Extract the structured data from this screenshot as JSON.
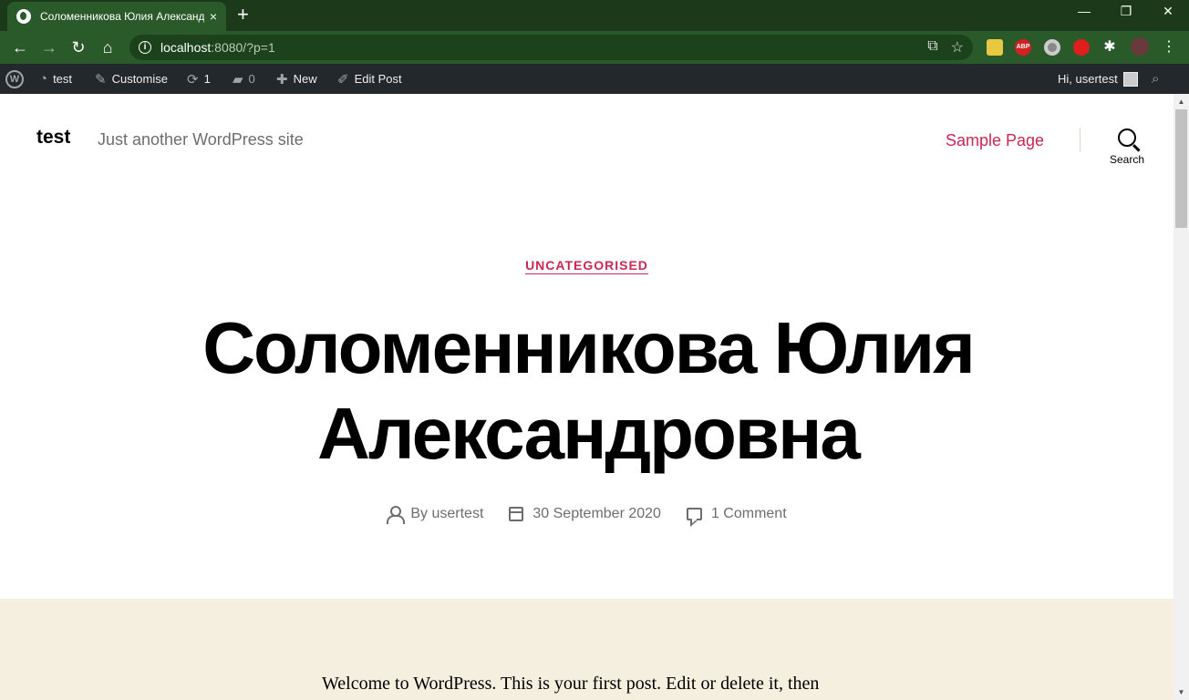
{
  "browser": {
    "tab_title": "Соломенникова Юлия Александровна – test",
    "url_host": "localhost",
    "url_rest": ":8080/?p=1",
    "new_tab": "+",
    "close_tab": "×",
    "win_minimize": "—",
    "win_restore": "❐",
    "win_close": "✕",
    "ext_abp": "ABP"
  },
  "adminbar": {
    "wp_logo": "W",
    "site_name": "test",
    "customise": "Customise",
    "updates_count": "1",
    "comments_count": "0",
    "new": "New",
    "edit_post": "Edit Post",
    "greeting": "Hi, usertest"
  },
  "header": {
    "site_title": "test",
    "site_description": "Just another WordPress site",
    "nav_link": "Sample Page",
    "search_label": "Search"
  },
  "post": {
    "category": "UNCATEGORISED",
    "title_line1": "Соломенникова Юлия",
    "title_line2": "Александровна",
    "author": "By usertest",
    "date": "30 September 2020",
    "comments": "1 Comment",
    "excerpt": "Welcome to WordPress. This is your first post. Edit or delete it, then"
  },
  "colors": {
    "accent": "#cd2653",
    "chrome_dark": "#1c3a1a",
    "chrome": "#2a5a2a",
    "adminbar": "#23282d",
    "content_bg": "#f5efe0"
  }
}
